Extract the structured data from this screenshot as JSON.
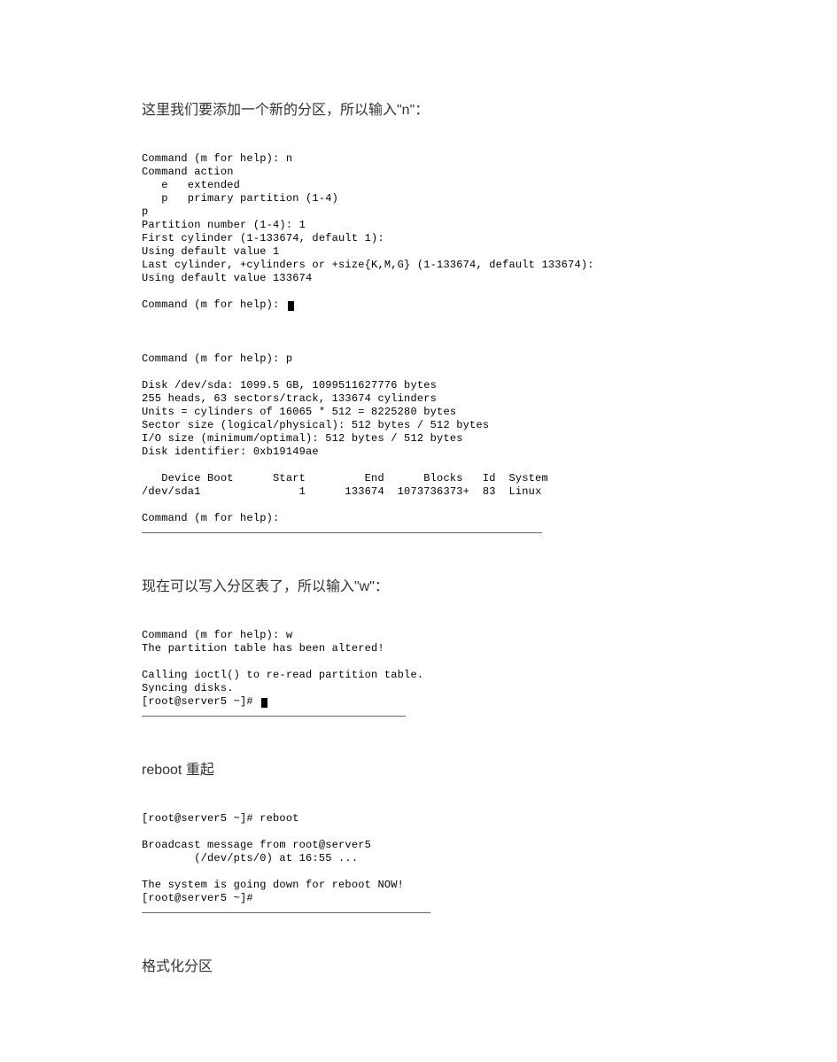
{
  "heading1": "这里我们要添加一个新的分区，所以输入\"n\"：",
  "terminal1": "Command (m for help): n\nCommand action\n   e   extended\n   p   primary partition (1-4)\np\nPartition number (1-4): 1\nFirst cylinder (1-133674, default 1):\nUsing default value 1\nLast cylinder, +cylinders or +size{K,M,G} (1-133674, default 133674):\nUsing default value 133674\n\nCommand (m for help): ",
  "terminal2": "Command (m for help): p\n\nDisk /dev/sda: 1099.5 GB, 1099511627776 bytes\n255 heads, 63 sectors/track, 133674 cylinders\nUnits = cylinders of 16065 * 512 = 8225280 bytes\nSector size (logical/physical): 512 bytes / 512 bytes\nI/O size (minimum/optimal): 512 bytes / 512 bytes\nDisk identifier: 0xb19149ae\n\n   Device Boot      Start         End      Blocks   Id  System\n/dev/sda1               1      133674  1073736373+  83  Linux\n\nCommand (m for help):",
  "heading2": "现在可以写入分区表了，所以输入\"w\"：",
  "terminal3": "Command (m for help): w\nThe partition table has been altered!\n\nCalling ioctl() to re-read partition table.\nSyncing disks.\n[root@server5 ~]# ",
  "heading3": "reboot 重起",
  "terminal4": "[root@server5 ~]# reboot\n\nBroadcast message from root@server5\n        (/dev/pts/0) at 16:55 ...\n\nThe system is going down for reboot NOW!\n[root@server5 ~]#",
  "heading4": "格式化分区"
}
